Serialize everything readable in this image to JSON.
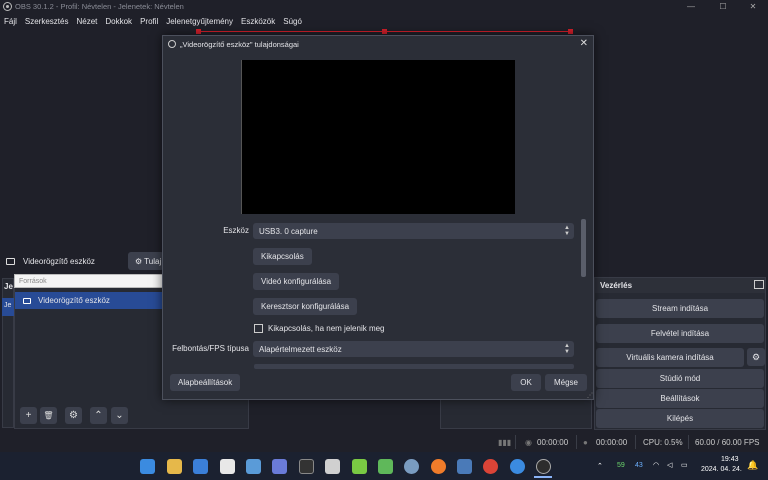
{
  "window": {
    "title": "OBS 30.1.2 - Profil: Névtelen - Jelenetek: Névtelen",
    "minimize": "—",
    "maximize": "☐",
    "close": "✕"
  },
  "menu": [
    "Fájl",
    "Szerkesztés",
    "Nézet",
    "Dokkok",
    "Profil",
    "Jelenetgyűjtemény",
    "Eszközök",
    "Súgó"
  ],
  "source_bar": {
    "name": "Videorögzítő eszköz",
    "properties_label": "Tulaj"
  },
  "sources_panel": {
    "tooltip": "Források",
    "item": "Videorögzítő eszköz",
    "left_stub_top": "Je",
    "left_stub": "Je"
  },
  "toolbar": {
    "add": "+",
    "remove": "🗑",
    "settings": "⚙",
    "up": "⌃",
    "down": "⌄"
  },
  "controls": {
    "title": "Vezérlés",
    "buttons": [
      "Stream indítása",
      "Felvétel indítása",
      "Virtuális kamera indítása",
      "Stúdió mód",
      "Beállítások",
      "Kilépés"
    ]
  },
  "statusbar": {
    "stream_time": "00:00:00",
    "rec_time": "00:00:00",
    "cpu": "CPU: 0.5%",
    "fps": "60.00 / 60.00 FPS"
  },
  "dialog": {
    "title": "„Videorögzítő eszköz\" tulajdonságai",
    "device_label": "Eszköz",
    "device_value": "USB3. 0 capture",
    "disconnect_button": "Kikapcsolás",
    "video_config_button": "Videó konfigurálása",
    "crossbar_config_button": "Keresztsor konfigurálása",
    "checkbox_label": "Kikapcsolás, ha nem jelenik meg",
    "resolution_label": "Felbontás/FPS típusa",
    "resolution_value": "Alapértelmezett eszköz",
    "defaults_button": "Alapbeállítások",
    "ok_button": "OK",
    "cancel_button": "Mégse"
  },
  "taskbar": {
    "time": "19:43",
    "date": "2024. 04. 24.",
    "tray_a": "59",
    "tray_b": "43"
  },
  "colors": {
    "background": "#1f2029",
    "panel": "#272a33",
    "button": "#3c404d",
    "selection": "#284b96",
    "accent_red": "#d21f2b"
  }
}
